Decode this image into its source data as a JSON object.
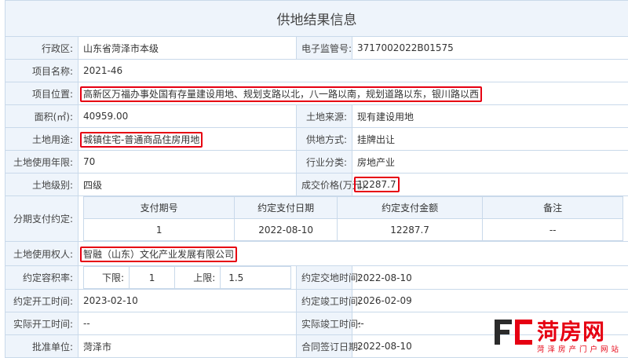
{
  "title": "供地结果信息",
  "region": {
    "label": "行政区:",
    "value": "山东省菏泽市本级"
  },
  "supervise": {
    "label": "电子监管号:",
    "value": "3717002022B01575"
  },
  "project_name": {
    "label": "项目名称:",
    "value": "2021-46"
  },
  "location": {
    "label": "项目位置:",
    "value": "高新区万福办事处国有存量建设用地、规划支路以北，八一路以南，规划道路以东，银川路以西"
  },
  "area": {
    "label": "面积(㎡):",
    "value": "40959.00"
  },
  "source": {
    "label": "土地来源:",
    "value": "现有建设用地"
  },
  "usage": {
    "label": "土地用途:",
    "value": "城镇住宅-普通商品住房用地"
  },
  "supply": {
    "label": "供地方式:",
    "value": "挂牌出让"
  },
  "years": {
    "label": "土地使用年限:",
    "value": "70"
  },
  "industry": {
    "label": "行业分类:",
    "value": "房地产业"
  },
  "level": {
    "label": "土地级别:",
    "value": "四级"
  },
  "price": {
    "label": "成交价格(万元):",
    "value": "12287.7"
  },
  "installment": {
    "label": "分期支付约定:",
    "headers": [
      "支付期号",
      "约定支付日期",
      "约定支付金额",
      "备注"
    ],
    "row": [
      "1",
      "2022-08-10",
      "12287.7",
      "--"
    ]
  },
  "owner": {
    "label": "土地使用权人:",
    "value": "智融（山东）文化产业发展有限公司"
  },
  "ratio": {
    "label": "约定容积率:",
    "lower_label": "下限:",
    "lower": "1",
    "upper_label": "上限:",
    "upper": "1.5"
  },
  "deliver": {
    "label": "约定交地时间:",
    "value": "2022-08-10"
  },
  "start": {
    "label": "约定开工时间:",
    "value": "2023-02-10"
  },
  "finish": {
    "label": "约定竣工时间:",
    "value": "2026-02-09"
  },
  "act_start": {
    "label": "实际开工时间:",
    "value": "--"
  },
  "act_finish": {
    "label": "实际竣工时间:",
    "value": "--"
  },
  "approver": {
    "label": "批准单位:",
    "value": "菏泽市"
  },
  "contract": {
    "label": "合同签订日期:",
    "value": "2022-08-10"
  },
  "watermark": {
    "brand": "菏房网",
    "sub": "菏泽房产门户网站"
  },
  "colors": {
    "header_bg": "#eef4fb",
    "border": "#c9d9ea",
    "highlight": "#e60012"
  }
}
